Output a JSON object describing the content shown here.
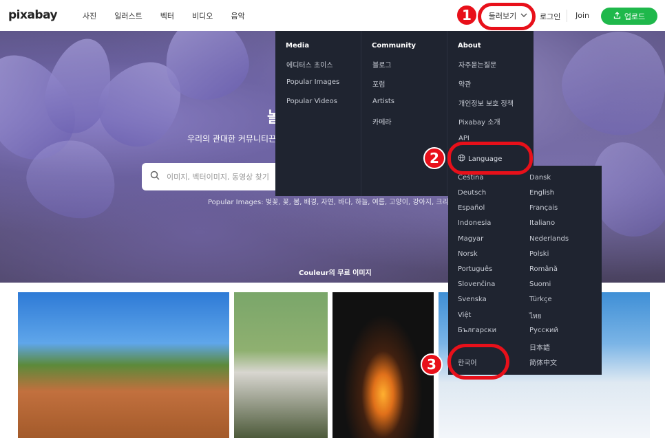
{
  "header": {
    "logo": "pixabay",
    "nav": [
      "사진",
      "일러스트",
      "벡터",
      "비디오",
      "음악"
    ],
    "explore_label": "둘러보기",
    "login_label": "로그인",
    "join_label": "Join",
    "upload_label": "업로드"
  },
  "hero": {
    "title_fragment": "놀",
    "subtitle": "우리의 관대한 커뮤니티끈",
    "search_placeholder": "이미지, 벡터이미지, 동영상 찾기",
    "popular": "Popular Images: 벚꽃, 꽃, 봄, 배경, 자연, 바다, 하늘, 여름, 고양이, 강아지, 크리스마스",
    "caption": "Couleur의 무료 이미지"
  },
  "menu": {
    "media": {
      "heading": "Media",
      "items": [
        "에디터스 초이스",
        "Popular Images",
        "Popular Videos"
      ]
    },
    "community": {
      "heading": "Community",
      "items": [
        "블로그",
        "포럼",
        "Artists",
        "카메라"
      ]
    },
    "about": {
      "heading": "About",
      "items": [
        "자주묻는질문",
        "약관",
        "개인정보 보호 정책",
        "Pixabay 소개",
        "API"
      ],
      "language_label": "Language"
    }
  },
  "languages": {
    "left": [
      "Čeština",
      "Deutsch",
      "Español",
      "Indonesia",
      "Magyar",
      "Norsk",
      "Português",
      "Slovenčina",
      "Svenska",
      "Việt",
      "Български",
      "",
      "한국어"
    ],
    "right": [
      "Dansk",
      "English",
      "Français",
      "Italiano",
      "Nederlands",
      "Polski",
      "Română",
      "Suomi",
      "Türkçe",
      "ไทย",
      "Русский",
      "日本語",
      "简体中文"
    ]
  },
  "callouts": [
    "1",
    "2",
    "3"
  ],
  "colors": {
    "accent_green": "#1fb84b",
    "menu_bg": "#1f2430",
    "callout_red": "#e8101a"
  }
}
